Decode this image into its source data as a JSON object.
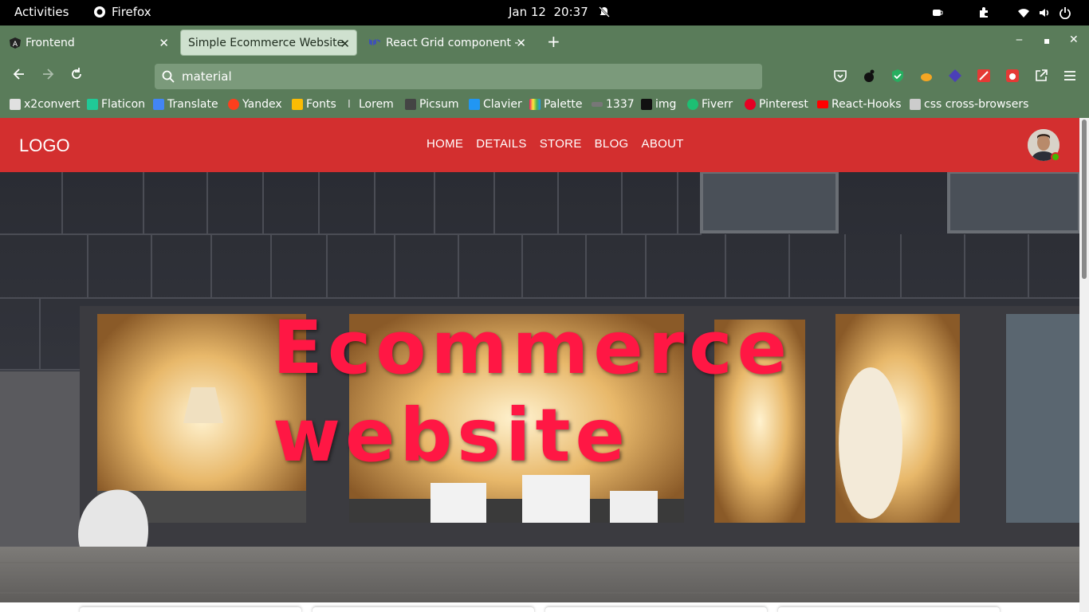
{
  "os": {
    "activities": "Activities",
    "app_name": "Firefox",
    "clock": "Jan 12  20:37"
  },
  "browser": {
    "tabs": [
      {
        "title": "Frontend",
        "icon": "angular-icon"
      },
      {
        "title": "Simple Ecommerce Website",
        "icon": "none"
      },
      {
        "title": "React Grid component - M",
        "icon": "mui-icon"
      }
    ],
    "url": "material",
    "bookmarks": [
      {
        "label": "x2convert",
        "color": "#e0e0e0"
      },
      {
        "label": "Flaticon",
        "color": "#20c997"
      },
      {
        "label": "Translate",
        "color": "#4285f4"
      },
      {
        "label": "Yandex",
        "color": "#fc3f1d"
      },
      {
        "label": "Fonts",
        "color": "#fbbc04"
      },
      {
        "label": "Lorem",
        "color": "#999999"
      },
      {
        "label": "Picsum",
        "color": "#444444"
      },
      {
        "label": "Clavier",
        "color": "#2196f3"
      },
      {
        "label": "Palette",
        "color": "#ff9800"
      },
      {
        "label": "1337",
        "color": "#777777"
      },
      {
        "label": "img",
        "color": "#111111"
      },
      {
        "label": "Fiverr",
        "color": "#1dbf73"
      },
      {
        "label": "Pinterest",
        "color": "#e60023"
      },
      {
        "label": "React-Hooks",
        "color": "#ff0000"
      },
      {
        "label": "css cross-browsers",
        "color": "#cccccc"
      }
    ]
  },
  "site": {
    "logo": "LOGO",
    "nav": [
      "HOME",
      "DETAILS",
      "STORE",
      "BLOG",
      "ABOUT"
    ],
    "hero_title": "Ecommerce website",
    "brand_color": "#d32f2f",
    "hero_title_color": "#ff1744"
  }
}
